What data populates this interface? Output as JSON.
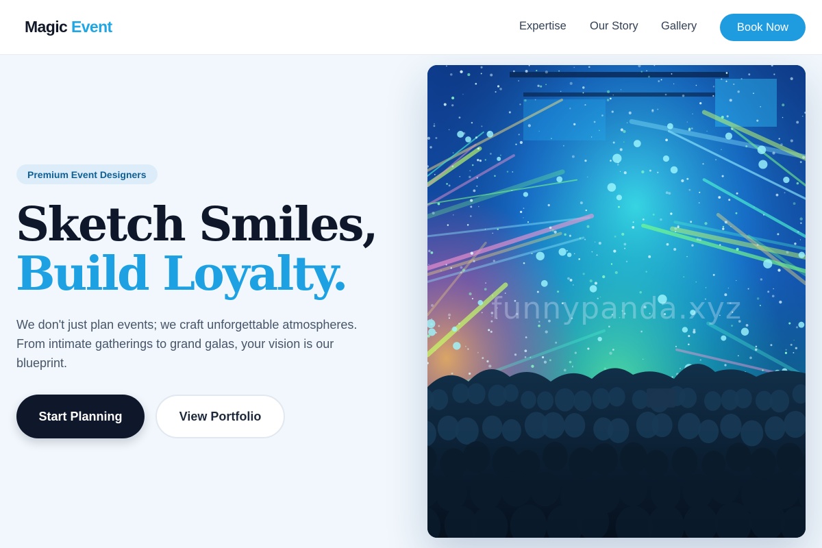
{
  "brand": {
    "name_primary": "Magic",
    "name_accent": "Event",
    "accent_color": "#1fa6e3"
  },
  "nav": {
    "links": [
      {
        "label": "Expertise"
      },
      {
        "label": "Our Story"
      },
      {
        "label": "Gallery"
      }
    ],
    "cta_label": "Book Now",
    "cta_color": "#1f9be0"
  },
  "hero": {
    "badge": "Premium Event Designers",
    "headline_line1": "Sketch Smiles,",
    "headline_line2": "Build Loyalty.",
    "description": "We don't just plan events; we craft unforgettable atmospheres. From intimate gatherings to grand galas, your vision is our blueprint.",
    "primary_button": "Start Planning",
    "secondary_button": "View Portfolio",
    "dark_color": "#0f172a"
  },
  "image": {
    "subject": "concert-crowd-with-stage-lights-and-confetti",
    "watermark": "funnypanda.xyz"
  }
}
